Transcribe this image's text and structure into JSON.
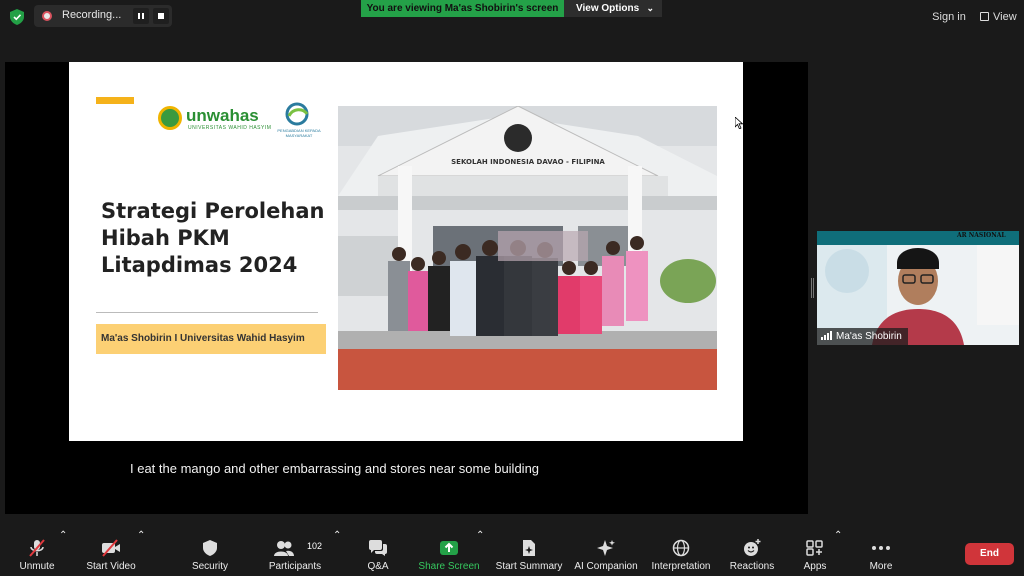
{
  "recording": {
    "label": "Recording..."
  },
  "banner": {
    "viewing": "You are viewing Ma'as Shobirin's screen",
    "view_options": "View Options"
  },
  "top_right": {
    "sign_in": "Sign in",
    "view": "View"
  },
  "slide": {
    "logo_word": "unwahas",
    "logo_sub": "UNIVERSITAS WAHID HASYIM",
    "logo2_sub": "PENGABDIAN KEPADA MASYARAKAT",
    "title": "Strategi Perolehan Hibah PKM Litapdimas 2024",
    "author": "Ma'as Shobirin I Universitas Wahid Hasyim",
    "photo_sign": "SEKOLAH INDONESIA DAVAO - FILIPINA"
  },
  "caption": "I eat the mango and other embarrassing and stores near some building",
  "camera": {
    "name": "Ma'as Shobirin",
    "banner_text": "AR NASIONAL"
  },
  "toolbar": {
    "unmute": "Unmute",
    "start_video": "Start Video",
    "security": "Security",
    "participants": "Participants",
    "participants_count": "102",
    "qa": "Q&A",
    "share_screen": "Share Screen",
    "start_summary": "Start Summary",
    "ai_companion": "AI Companion",
    "interpretation": "Interpretation",
    "reactions": "Reactions",
    "apps": "Apps",
    "more": "More",
    "end": "End"
  },
  "colors": {
    "share_green": "#24a148",
    "end_red": "#d0353a",
    "slide_yellow": "#f5b21a",
    "author_bg": "#fcd074"
  }
}
